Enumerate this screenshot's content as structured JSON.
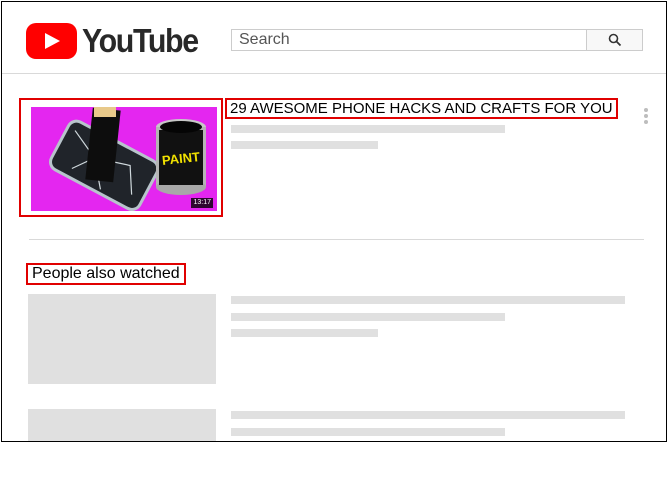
{
  "header": {
    "logo_text": "YouTube",
    "search_placeholder": "Search"
  },
  "video": {
    "title": "29 AWESOME PHONE HACKS AND CRAFTS FOR YOU",
    "duration": "13:17",
    "thumbnail_text": "PAINT"
  },
  "section": {
    "heading": "People also watched"
  },
  "colors": {
    "brand_red": "#ff0000",
    "highlight_red": "#e00000",
    "thumbnail_bg": "#e426f0",
    "placeholder": "#e0e0e0"
  }
}
